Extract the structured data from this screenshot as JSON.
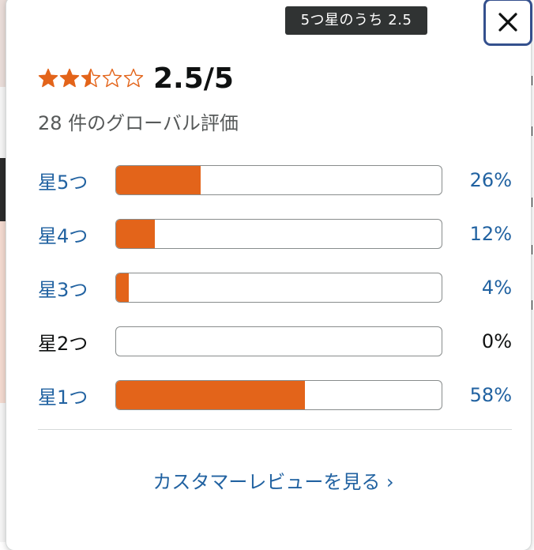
{
  "tooltip": {
    "text": "5つ星のうち 2.5"
  },
  "rating": {
    "stars": 2.5,
    "max": 5,
    "display": "2.5/5",
    "count_text": "28 件のグローバル評価"
  },
  "histogram": [
    {
      "label": "星5つ",
      "percent_text": "26%",
      "percent": 26,
      "enabled": true
    },
    {
      "label": "星4つ",
      "percent_text": "12%",
      "percent": 12,
      "enabled": true
    },
    {
      "label": "星3つ",
      "percent_text": "4%",
      "percent": 4,
      "enabled": true
    },
    {
      "label": "星2つ",
      "percent_text": "0%",
      "percent": 0,
      "enabled": false
    },
    {
      "label": "星1つ",
      "percent_text": "58%",
      "percent": 58,
      "enabled": true
    }
  ],
  "footer": {
    "link_text": "カスタマーレビューを見る ›"
  },
  "colors": {
    "accent": "#e3641a",
    "link": "#2162a1",
    "close_border": "#34508d"
  },
  "icons": {
    "close": "close-icon",
    "star_full": "star-full-icon",
    "star_half": "star-half-icon",
    "star_empty": "star-empty-icon"
  }
}
